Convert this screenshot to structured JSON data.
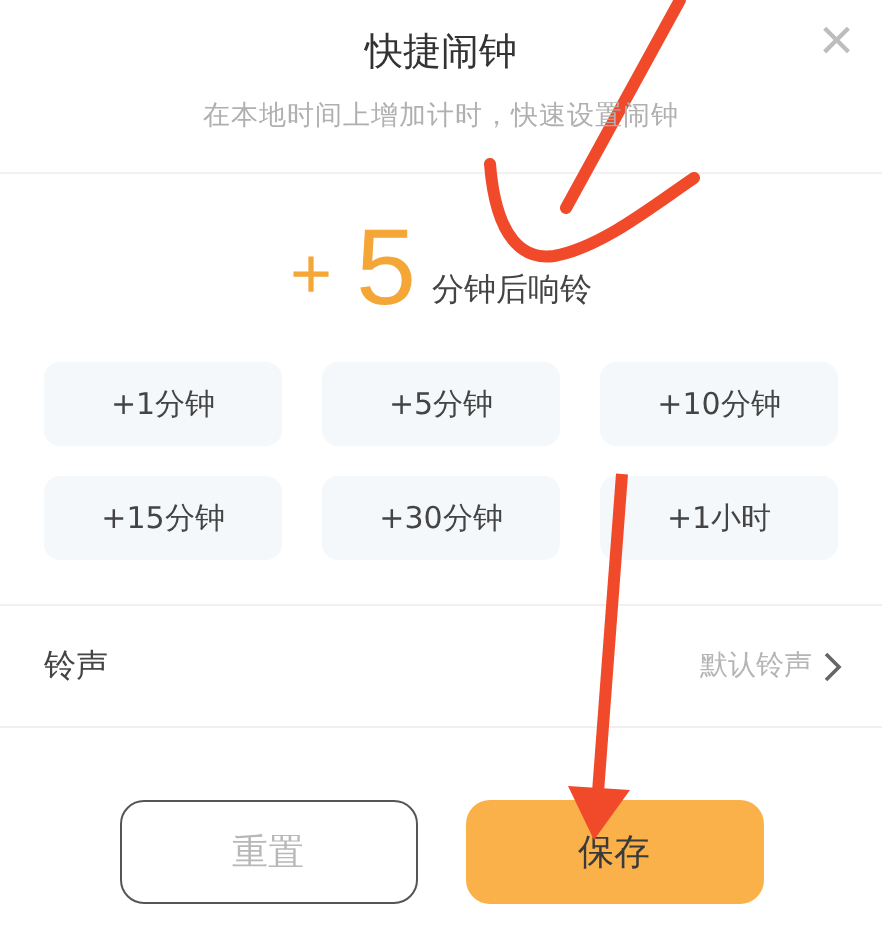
{
  "dialog": {
    "title": "快捷闹钟",
    "subtitle": "在本地时间上增加计时，快速设置闹钟",
    "close": "×"
  },
  "summary": {
    "sign": "+",
    "amount": "5",
    "suffix": "分钟后响铃"
  },
  "presets": [
    {
      "label": "+1分钟"
    },
    {
      "label": "+5分钟"
    },
    {
      "label": "+10分钟"
    },
    {
      "label": "+15分钟"
    },
    {
      "label": "+30分钟"
    },
    {
      "label": "+1小时"
    }
  ],
  "ringtone": {
    "label": "铃声",
    "value": "默认铃声"
  },
  "buttons": [
    {
      "label": "重置",
      "kind": "secondary",
      "disabled": true
    },
    {
      "label": "保存",
      "kind": "primary",
      "disabled": false
    }
  ]
}
